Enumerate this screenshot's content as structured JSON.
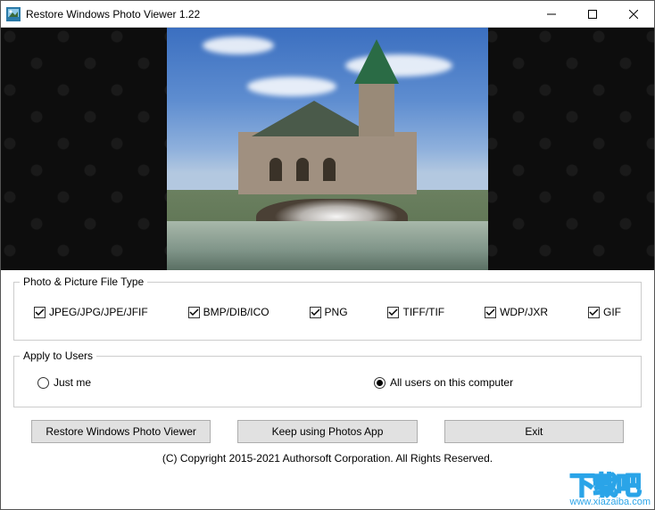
{
  "window": {
    "title": "Restore Windows Photo Viewer 1.22"
  },
  "filetypes": {
    "legend": "Photo & Picture File Type",
    "items": [
      {
        "label": "JPEG/JPG/JPE/JFIF",
        "checked": true
      },
      {
        "label": "BMP/DIB/ICO",
        "checked": true
      },
      {
        "label": "PNG",
        "checked": true
      },
      {
        "label": "TIFF/TIF",
        "checked": true
      },
      {
        "label": "WDP/JXR",
        "checked": true
      },
      {
        "label": "GIF",
        "checked": true
      }
    ]
  },
  "users": {
    "legend": "Apply to Users",
    "justme": "Just me",
    "allusers": "All users on this computer",
    "selected": "allusers"
  },
  "buttons": {
    "restore": "Restore Windows Photo Viewer",
    "keep": "Keep using Photos App",
    "exit": "Exit"
  },
  "copyright": "(C) Copyright 2015-2021 Authorsoft Corporation. All Rights Reserved.",
  "watermark": {
    "text": "下载吧",
    "url": "www.xiazaiba.com"
  }
}
